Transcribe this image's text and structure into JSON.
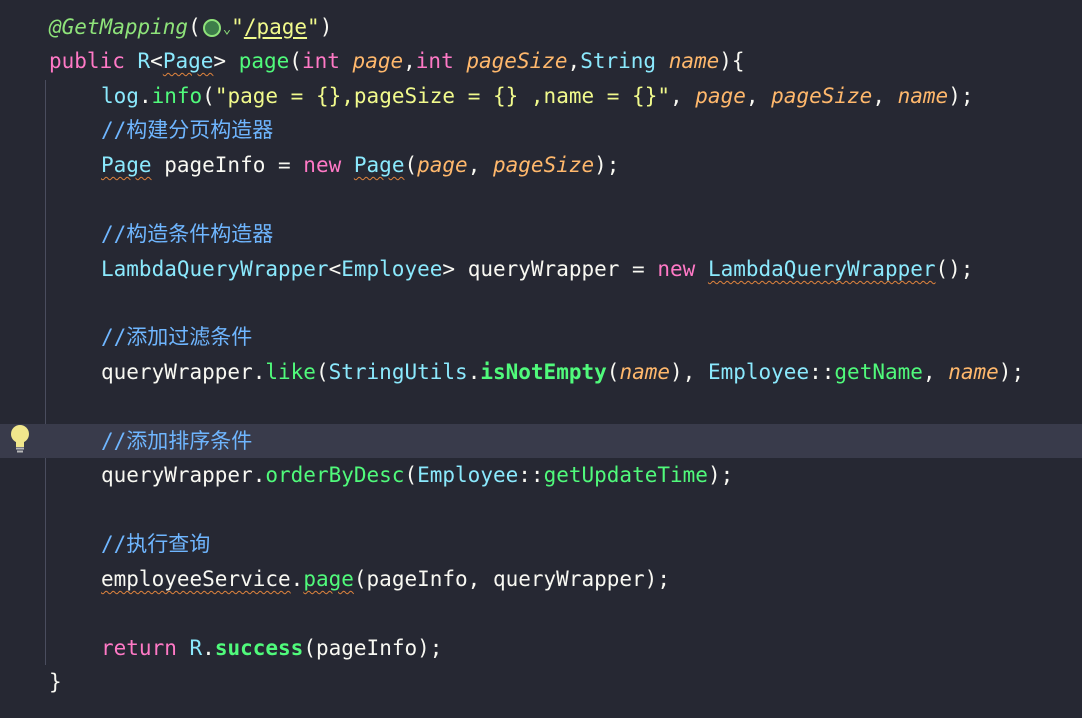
{
  "editor": {
    "lines": {
      "l1": {
        "annotation": "@GetMapping",
        "open": "(",
        "quote1": "\"",
        "path": "/page",
        "quote2": "\"",
        "close": ")"
      },
      "l2": {
        "kw_public": "public",
        "type_r": "R",
        "lt": "<",
        "type_page": "Page",
        "gt": ">",
        "method": "page",
        "open": "(",
        "kw_int1": "int",
        "param_page": "page",
        "comma1": ",",
        "kw_int2": "int",
        "param_pagesize": "pageSize",
        "comma2": ",",
        "type_string": "String",
        "param_name": "name",
        "close": "){"
      },
      "l3": {
        "obj": "log",
        "dot": ".",
        "fn": "info",
        "open": "(",
        "str": "\"page = {},pageSize = {} ,name = {}\"",
        "comma1": ", ",
        "arg1": "page",
        "comma2": ", ",
        "arg2": "pageSize",
        "comma3": ", ",
        "arg3": "name",
        "close": ");"
      },
      "l4": {
        "comment": "//构建分页构造器"
      },
      "l5": {
        "type": "Page",
        "var": " pageInfo = ",
        "kw_new": "new",
        "type2": "Page",
        "open": "(",
        "arg1": "page",
        "comma": ", ",
        "arg2": "pageSize",
        "close": ");"
      },
      "l6": {
        "comment": "//构造条件构造器"
      },
      "l7": {
        "type": "LambdaQueryWrapper",
        "lt": "<",
        "generic": "Employee",
        "gt": ">",
        "var": " queryWrapper = ",
        "kw_new": "new",
        "type2": "LambdaQueryWrapper",
        "close": "();"
      },
      "l8": {
        "comment": "//添加过滤条件"
      },
      "l9": {
        "obj": "queryWrapper",
        "dot": ".",
        "fn": "like",
        "open": "(",
        "cls": "StringUtils",
        "dot2": ".",
        "fn2": "isNotEmpty",
        "open2": "(",
        "arg": "name",
        "close2": "), ",
        "cls2": "Employee",
        "sep": "::",
        "ref": "getName",
        "comma": ", ",
        "arg2": "name",
        "close": ");"
      },
      "l10": {
        "comment": "//添加排序条件"
      },
      "l11": {
        "obj": "queryWrapper",
        "dot": ".",
        "fn": "orderByDesc",
        "open": "(",
        "cls": "Employee",
        "sep": "::",
        "ref": "getUpdateTime",
        "close": ");"
      },
      "l12": {
        "comment": "//执行查询"
      },
      "l13": {
        "obj": "employeeService",
        "dot": ".",
        "fn": "page",
        "args": "(pageInfo, queryWrapper);"
      },
      "l14": {
        "kw_return": "return",
        "sp": " ",
        "cls": "R",
        "dot": ".",
        "fn": "success",
        "args": "(pageInfo);"
      },
      "l15": {
        "brace": "}"
      }
    }
  }
}
